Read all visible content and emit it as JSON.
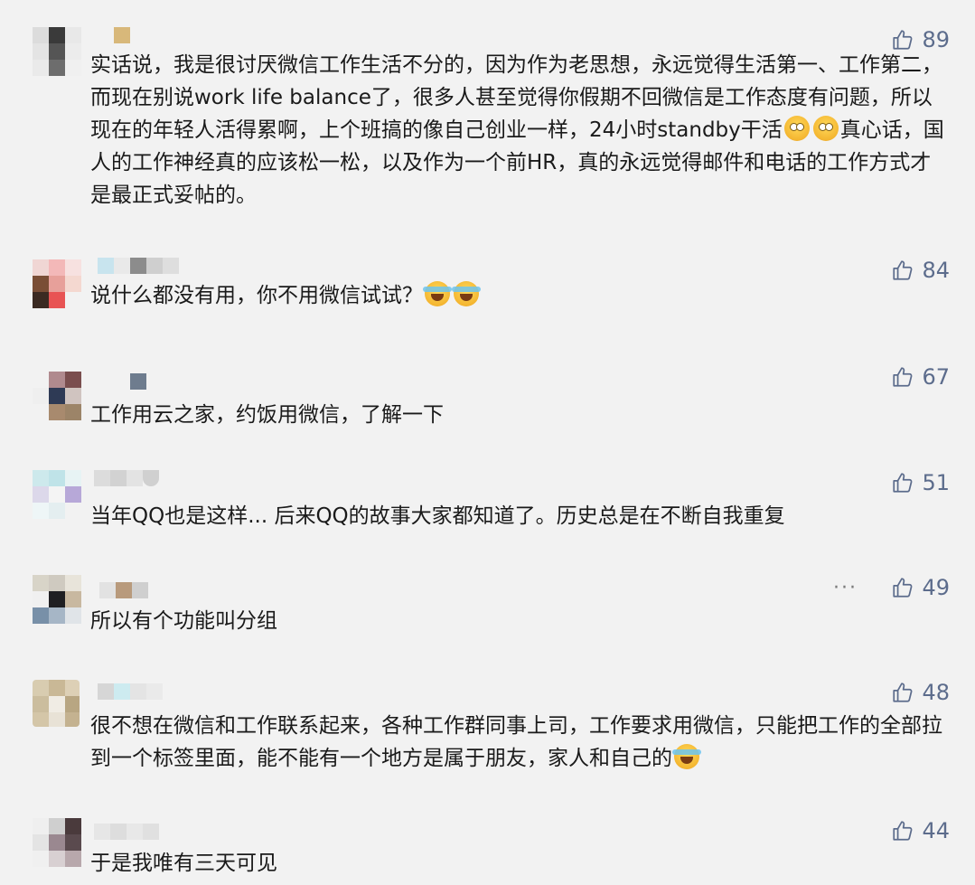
{
  "comments": [
    {
      "likes": "89",
      "text_before": "实话说，我是很讨厌微信工作生活不分的，因为作为老思想，永远觉得生活第一、工作第二，而现在别说work life balance了，很多人甚至觉得你假期不回微信是工作态度有问题，所以现在的年轻人活得累啊，上个班搞的像自己创业一样，24小时standby干活",
      "text_after": "真心话，国人的工作神经真的应该松一松，以及作为一个前HR，真的永远觉得邮件和电话的工作方式才是最正式妥帖的。",
      "emojis": [
        "eye-roll",
        "eye-roll"
      ]
    },
    {
      "likes": "84",
      "text_before": "说什么都没有用，你不用微信试试？",
      "text_after": "",
      "emojis": [
        "crying-laugh",
        "crying-laugh"
      ]
    },
    {
      "likes": "67",
      "text_before": "工作用云之家，约饭用微信，了解一下",
      "text_after": "",
      "emojis": []
    },
    {
      "likes": "51",
      "text_before": "当年QQ也是这样... 后来QQ的故事大家都知道了。历史总是在不断自我重复",
      "text_after": "",
      "emojis": []
    },
    {
      "likes": "49",
      "more": "···",
      "text_before": "所以有个功能叫分组",
      "text_after": "",
      "emojis": []
    },
    {
      "likes": "48",
      "text_before": "很不想在微信和工作联系起来，各种工作群同事上司，工作要求用微信，只能把工作的全部拉到一个标签里面，能不能有一个地方是属于朋友，家人和自己的",
      "text_after": "",
      "emojis": [
        "crying-laugh"
      ]
    },
    {
      "likes": "44",
      "text_before": "于是我唯有三天可见",
      "text_after": "",
      "emojis": []
    }
  ],
  "colors": {
    "background": "#f2f2f2",
    "text": "#1a1a1a",
    "likes": "#5c6c8c"
  }
}
